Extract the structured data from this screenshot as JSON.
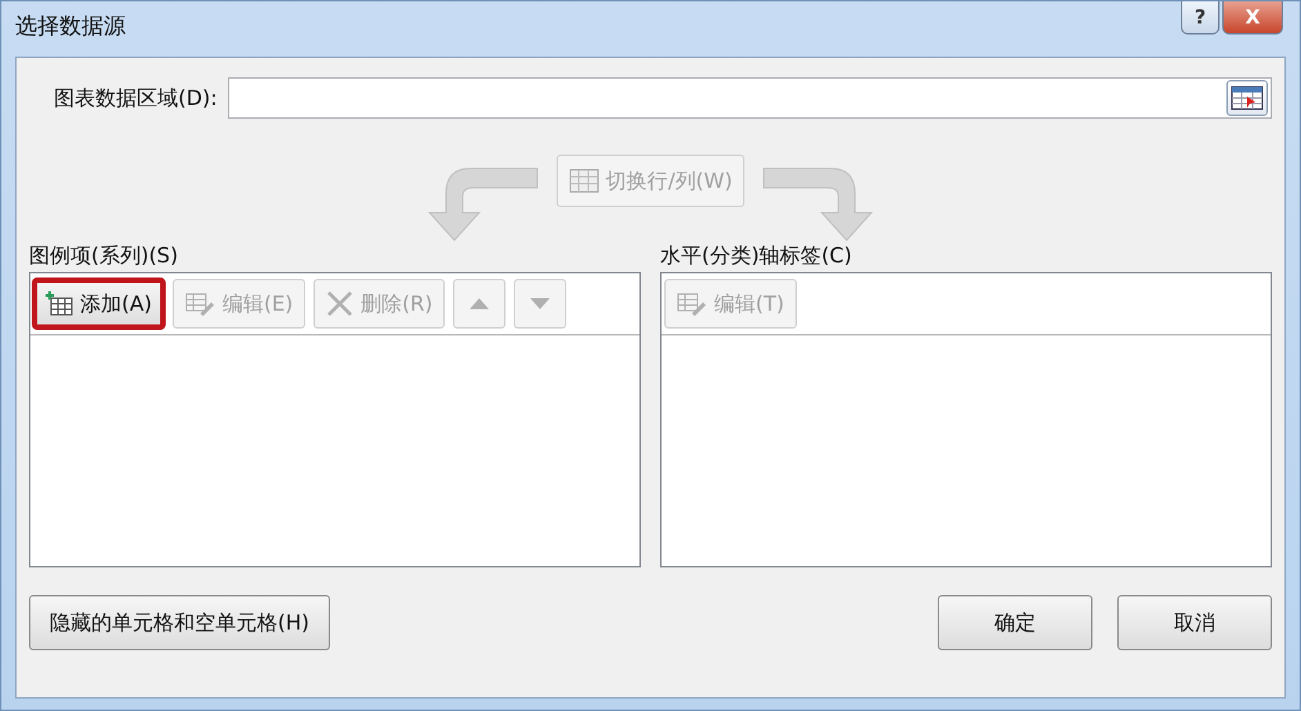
{
  "window": {
    "title": "选择数据源",
    "controls": [
      {
        "kind": "help",
        "label": "?"
      },
      {
        "kind": "close",
        "label": "X"
      }
    ]
  },
  "data_range": {
    "label": "图表数据区域(D):"
  },
  "switch_button": {
    "label": "切换行/列(W)",
    "disabled": true
  },
  "legend": {
    "label": "图例项(系列)(S)",
    "buttons": [
      {
        "kind": "add",
        "label": "添加(A)",
        "disabled": false,
        "highlighted": true
      },
      {
        "kind": "edit",
        "label": "编辑(E)",
        "disabled": true,
        "highlighted": false
      },
      {
        "kind": "delete",
        "label": "删除(R)",
        "disabled": true,
        "highlighted": false
      },
      {
        "kind": "up",
        "disabled": true,
        "highlighted": false
      },
      {
        "kind": "down",
        "disabled": true,
        "highlighted": false
      }
    ]
  },
  "axis": {
    "label": "水平(分类)轴标签(C)",
    "buttons": [
      {
        "kind": "edit",
        "label": "编辑(T)",
        "disabled": true,
        "highlighted": false
      }
    ]
  },
  "footer": {
    "hidden_cells_button": "隐藏的单元格和空单元格(H)",
    "buttons": [
      "确定",
      "取消"
    ]
  }
}
